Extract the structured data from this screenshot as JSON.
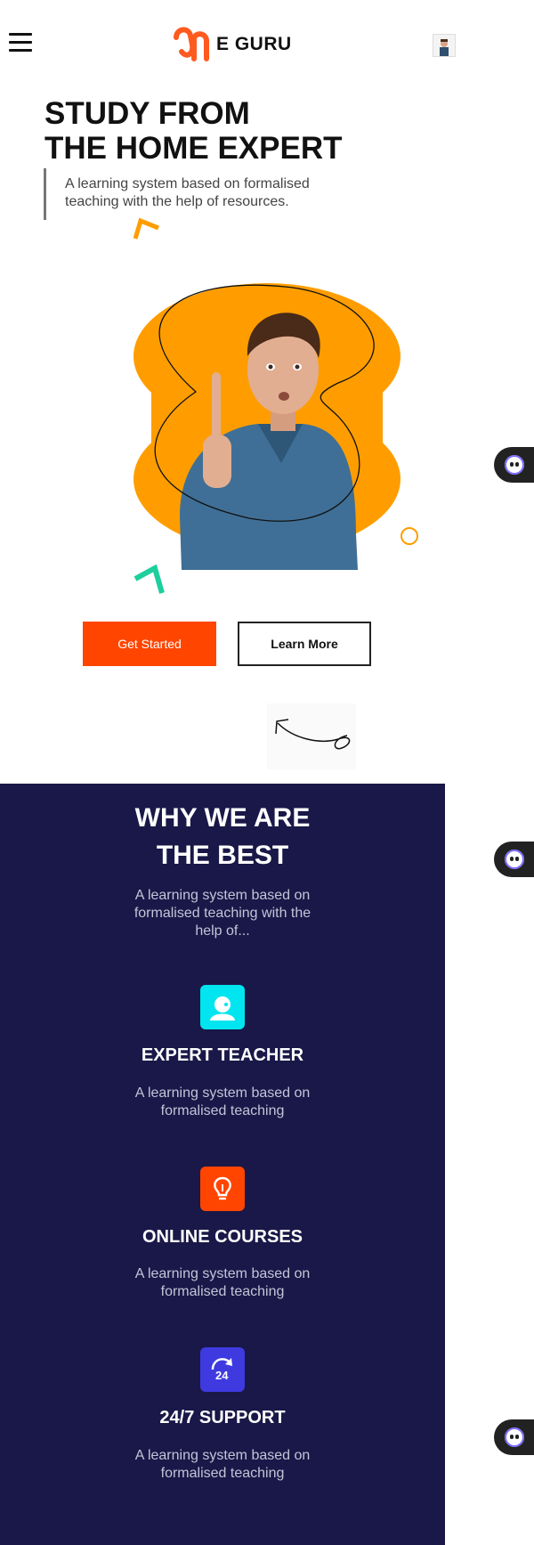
{
  "header": {
    "brand": "E GURU"
  },
  "hero": {
    "title_line1": "STUDY FROM",
    "title_line2": "THE HOME EXPERT",
    "description": "A learning system based on formalised teaching with the help of resources.",
    "cta_primary": "Get Started",
    "cta_secondary": "Learn More"
  },
  "why": {
    "title_line1": "WHY WE ARE",
    "title_line2": "THE BEST",
    "description": "A learning system based on formalised teaching with the help of...",
    "features": [
      {
        "title": "EXPERT TEACHER",
        "description": "A learning system based on formalised teaching",
        "icon": "teacher-icon",
        "color": "#00e5f0"
      },
      {
        "title": "ONLINE COURSES",
        "description": "A learning system based on formalised teaching",
        "icon": "lightbulb-icon",
        "color": "#ff4500"
      },
      {
        "title": "24/7 SUPPORT",
        "description": "A learning system based on formalised teaching",
        "icon": "support-24-icon",
        "color": "#3e3ae0"
      }
    ]
  },
  "colors": {
    "accent_orange": "#ff9d00",
    "cta_red": "#ff4500",
    "navy": "#191848",
    "teal": "#1ccf9d"
  }
}
